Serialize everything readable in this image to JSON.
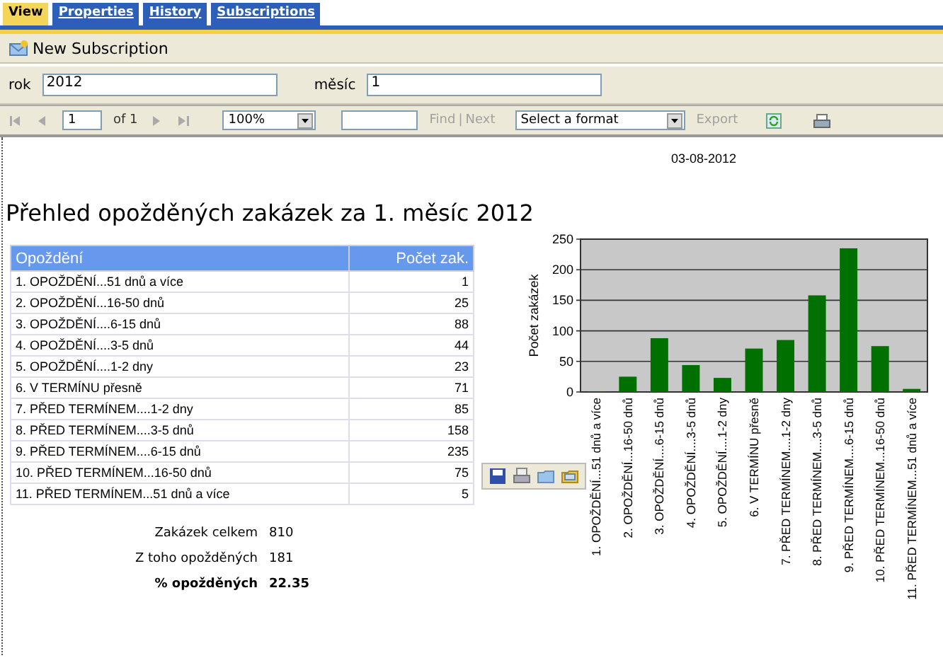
{
  "tabs": [
    {
      "label": "View",
      "selected": true
    },
    {
      "label": "Properties",
      "selected": false
    },
    {
      "label": "History",
      "selected": false
    },
    {
      "label": "Subscriptions",
      "selected": false
    }
  ],
  "toolbar": {
    "new_subscription": "New Subscription"
  },
  "parameters": [
    {
      "label": "rok",
      "value": "2012"
    },
    {
      "label": "měsíc",
      "value": "1"
    }
  ],
  "nav": {
    "buttons": [
      {
        "kind": "first",
        "disabled": true
      },
      {
        "kind": "prev",
        "disabled": true
      }
    ],
    "page": "1",
    "of": "of 1",
    "buttons_after": [
      {
        "kind": "next",
        "disabled": true
      },
      {
        "kind": "last",
        "disabled": true
      }
    ],
    "zoom": "100%",
    "find": "Find",
    "separator": "|",
    "next": "Next",
    "find_disabled": true,
    "format": "Select a format",
    "export": "Export",
    "export_disabled": true
  },
  "report": {
    "date": "03-08-2012",
    "title": "Přehled opožděných zakázek za 1. měsíc 2012",
    "table": {
      "columns": [
        "Opoždění",
        "Počet zak."
      ],
      "rows": [
        [
          "1. OPOŽDĚNÍ...51 dnů a více",
          "1"
        ],
        [
          "2. OPOŽDĚNÍ...16-50 dnů",
          "25"
        ],
        [
          "3. OPOŽDĚNÍ....6-15 dnů",
          "88"
        ],
        [
          "4. OPOŽDĚNÍ....3-5 dnů",
          "44"
        ],
        [
          "5. OPOŽDĚNÍ....1-2 dny",
          "23"
        ],
        [
          "6. V TERMÍNU přesně",
          "71"
        ],
        [
          "7. PŘED TERMÍNEM....1-2 dny",
          "85"
        ],
        [
          "8. PŘED TERMÍNEM....3-5 dnů",
          "158"
        ],
        [
          "9. PŘED TERMÍNEM....6-15 dnů",
          "235"
        ],
        [
          "10. PŘED TERMÍNEM...16-50 dnů",
          "75"
        ],
        [
          "11. PŘED TERMÍNEM...51 dnů a více",
          "5"
        ]
      ]
    },
    "summary": [
      {
        "label": "Zakázek celkem",
        "value": "810",
        "bold": false
      },
      {
        "label": "Z toho opožděných",
        "value": "181",
        "bold": false
      },
      {
        "label": "% opožděných",
        "value": "22.35",
        "bold": true
      }
    ],
    "chart_data": {
      "type": "bar",
      "ylabel": "Počet zakázek",
      "categories": [
        "1. OPOŽDĚNÍ...51 dnů a více",
        "2. OPOŽDĚNÍ...16-50 dnů",
        "3. OPOŽDĚNÍ....6-15 dnů",
        "4. OPOŽDĚNÍ....3-5 dnů",
        "5. OPOŽDĚNÍ....1-2 dny",
        "6. V TERMÍNU přesně",
        "7. PŘED TERMÍNEM....1-2 dny",
        "8. PŘED TERMÍNEM....3-5 dnů",
        "9. PŘED TERMÍNEM....6-15 dnů",
        "10. PŘED TERMÍNEM...16-50 dnů",
        "11. PŘED TERMÍNEM...51 dnů a více"
      ],
      "grid": true,
      "series": [
        {
          "color": "#007000",
          "values": [
            1,
            25,
            88,
            44,
            23,
            71,
            85,
            158,
            235,
            75,
            5
          ]
        }
      ],
      "ylim": [
        0,
        250
      ],
      "yticks": [
        0,
        50,
        100,
        150,
        200,
        250
      ]
    }
  }
}
